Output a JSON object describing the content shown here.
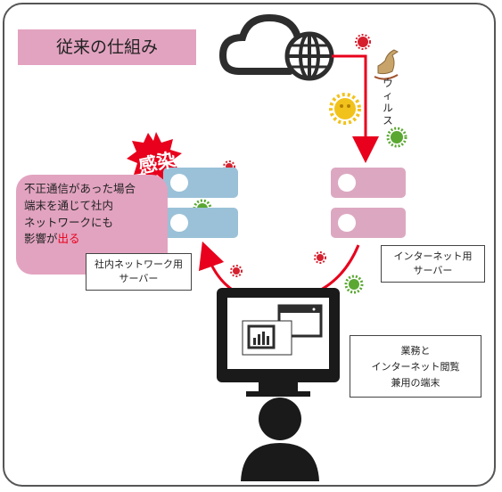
{
  "title": "従来の仕組み",
  "virus_label": "ウィルス",
  "infection_badge": "感染",
  "infection_note": {
    "line1": "不正通信があった場合",
    "line2": "端末を通じて社内",
    "line3": "ネットワークにも",
    "line4_prefix": "影響が",
    "line4_emphasis": "出る"
  },
  "internal_server_label": {
    "line1": "社内ネットワーク用",
    "line2": "サーバー"
  },
  "internet_server_label": {
    "line1": "インターネット用",
    "line2": "サーバー"
  },
  "terminal_label": {
    "line1": "業務と",
    "line2": "インターネット閲覧",
    "line3": "兼用の端末"
  },
  "colors": {
    "title_bg": "#e2a3c0",
    "internal_server": "#9ac1d8",
    "internet_server": "#dca8c1",
    "arrow_red": "#e8001c",
    "virus_red": "#d6202e",
    "virus_green": "#5aa832",
    "virus_yellow": "#f2c21c",
    "icon_dark": "#2d2d2d"
  }
}
